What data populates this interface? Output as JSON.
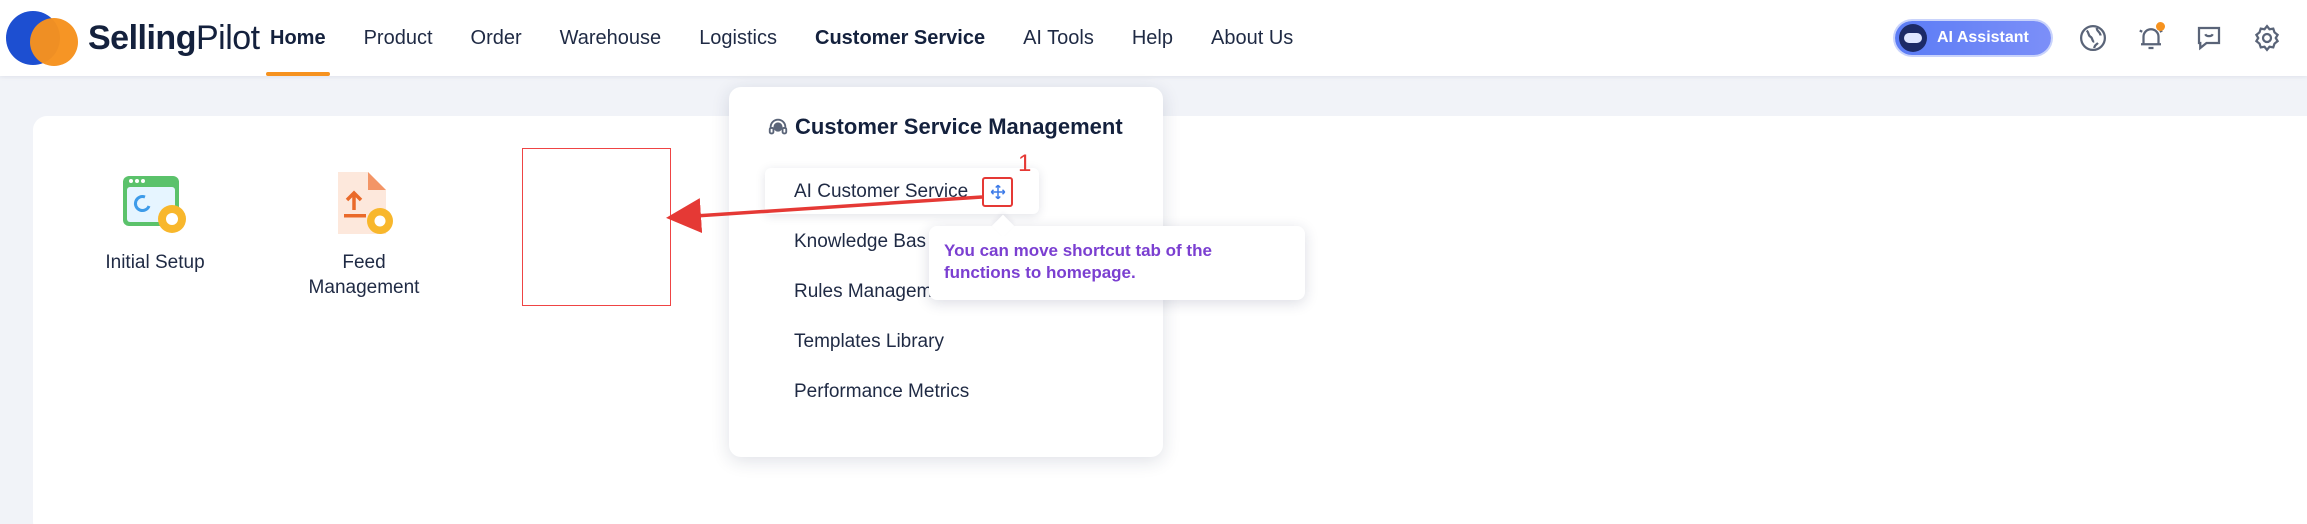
{
  "brand": {
    "name_bold": "Selling",
    "name_light": "Pilot"
  },
  "nav": {
    "items": [
      {
        "label": "Home"
      },
      {
        "label": "Product"
      },
      {
        "label": "Order"
      },
      {
        "label": "Warehouse"
      },
      {
        "label": "Logistics"
      },
      {
        "label": "Customer Service"
      },
      {
        "label": "AI Tools"
      },
      {
        "label": "Help"
      },
      {
        "label": "About Us"
      }
    ],
    "active": "Home",
    "hovered": "Customer Service"
  },
  "toolbar": {
    "ai_assistant_label": "AI Assistant",
    "icons": [
      "globe-icon",
      "bell-icon",
      "feedback-icon",
      "settings-icon"
    ]
  },
  "shortcuts": [
    {
      "label": "Initial Setup",
      "icon": "setup-gear-icon"
    },
    {
      "label": "Feed Management",
      "label_line1": "Feed",
      "label_line2": "Management",
      "icon": "feed-upload-icon"
    }
  ],
  "dropdown": {
    "title": "Customer Service Management",
    "items": [
      {
        "label": "AI Customer Service"
      },
      {
        "label": "Knowledge Bas"
      },
      {
        "label": "Rules Managem"
      },
      {
        "label": "Templates Library"
      },
      {
        "label": "Performance Metrics"
      }
    ]
  },
  "annotation": {
    "step_number": "1",
    "tooltip": "You can move shortcut tab of the functions to homepage."
  },
  "colors": {
    "brand_blue": "#1d4fd1",
    "brand_orange": "#f6921e",
    "annotation_red": "#e53935",
    "tooltip_purple": "#7b3fd1"
  }
}
